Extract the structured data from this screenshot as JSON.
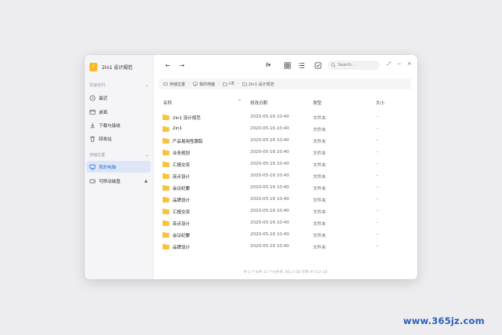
{
  "app": {
    "icon_glyph": "!",
    "title": "2in1 设计规范",
    "accent": "#f7b928"
  },
  "sidebar": {
    "quick_access_label": "快速访问",
    "quick_items": [
      {
        "label": "最近",
        "icon": "clock-icon"
      },
      {
        "label": "桌面",
        "icon": "desktop-icon"
      },
      {
        "label": "下载与接收",
        "icon": "download-icon"
      },
      {
        "label": "回收站",
        "icon": "trash-icon"
      }
    ],
    "storage_label": "存储位置",
    "storage_items": [
      {
        "label": "我的电脑",
        "icon": "computer-icon",
        "active": true
      },
      {
        "label": "可移动磁盘",
        "icon": "usb-drive-icon",
        "active": false
      }
    ],
    "eject_glyph": "▲",
    "active_color": "#2a6fdb"
  },
  "toolbar": {
    "back_glyph": "←",
    "forward_glyph": "→",
    "search_placeholder": "Search...",
    "win_restore": "⤢",
    "win_minimize": "−",
    "win_close": "×"
  },
  "breadcrumb": {
    "items": [
      "存储位置",
      "我的电脑",
      "UE",
      "2in1 设计规范"
    ],
    "separator": "›"
  },
  "columns": {
    "name": "名称",
    "date": "修改日期",
    "type": "类型",
    "size": "大小",
    "sort_glyph": "⌃"
  },
  "files": [
    {
      "name": "2in1 设计规范",
      "date": "2020-05-16  10:40",
      "type": "文件夹",
      "size": "--"
    },
    {
      "name": "2in1",
      "date": "2020-05-16  10:40",
      "type": "文件夹",
      "size": "--"
    },
    {
      "name": "产品易用性跟踪",
      "date": "2020-05-16  10:40",
      "type": "文件夹",
      "size": "--"
    },
    {
      "name": "业务规划",
      "date": "2020-05-16  10:40",
      "type": "文件夹",
      "size": "--"
    },
    {
      "name": "汇报交流",
      "date": "2020-05-16  10:40",
      "type": "文件夹",
      "size": "--"
    },
    {
      "name": "亮点设计",
      "date": "2020-05-16  10:40",
      "type": "文件夹",
      "size": "--"
    },
    {
      "name": "会议纪要",
      "date": "2020-05-16  10:40",
      "type": "文件夹",
      "size": "--"
    },
    {
      "name": "品牌设计",
      "date": "2020-05-16  10:40",
      "type": "文件夹",
      "size": "--"
    },
    {
      "name": "汇报交流",
      "date": "2020-05-16  10:40",
      "type": "文件夹",
      "size": "--"
    },
    {
      "name": "亮点设计",
      "date": "2020-05-16  10:40",
      "type": "文件夹",
      "size": "--"
    },
    {
      "name": "会议纪要",
      "date": "2020-05-16  10:40",
      "type": "文件夹",
      "size": "--"
    },
    {
      "name": "品牌设计",
      "date": "2020-05-16  10:40",
      "type": "文件夹",
      "size": "--"
    }
  ],
  "folder_color": "#f7c340",
  "status": "共 2 个文件    12 个文件夹    365.4 GB 可用  共 512 GB",
  "watermark": "www.365jz.com"
}
